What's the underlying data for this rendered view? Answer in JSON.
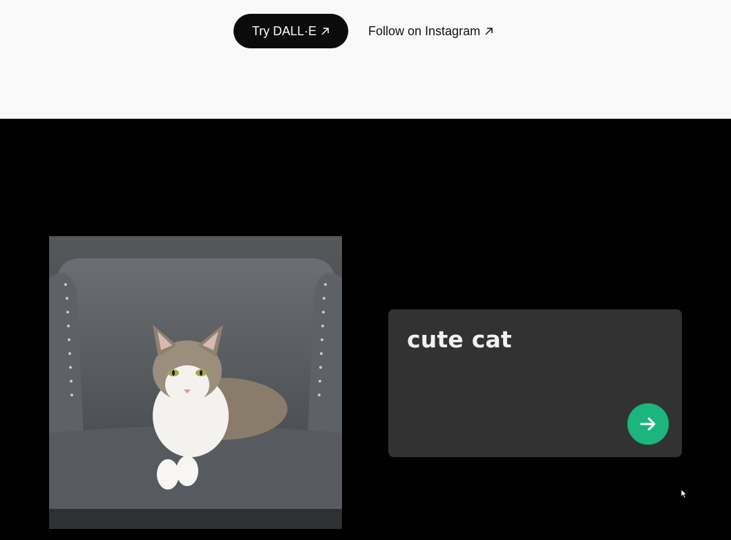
{
  "header": {
    "try_button_label": "Try DALL·E",
    "instagram_link_label": "Follow on Instagram"
  },
  "demo": {
    "image_alt": "Photo of a cute tabby and white cat lying on a grey armchair",
    "prompt_text": "cute cat",
    "submit_icon": "arrow-right-icon"
  },
  "colors": {
    "top_background": "#f9f9f9",
    "dark_background": "#000000",
    "button_dark": "#0b0b0b",
    "card_background": "#323232",
    "accent_green": "#1ab67e"
  }
}
